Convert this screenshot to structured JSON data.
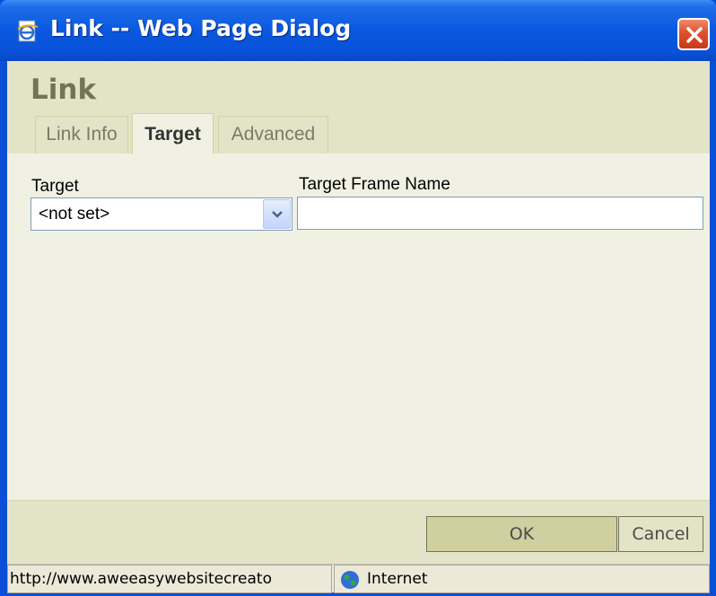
{
  "window": {
    "title": "Link -- Web Page Dialog",
    "icons": {
      "app": "ie-page-icon",
      "close": "close-icon"
    }
  },
  "dialog": {
    "title": "Link",
    "tabs": [
      {
        "label": "Link Info",
        "active": false
      },
      {
        "label": "Target",
        "active": true
      },
      {
        "label": "Advanced",
        "active": false
      }
    ]
  },
  "target_tab": {
    "target_label": "Target",
    "target_value": "<not set>",
    "frame_name_label": "Target Frame Name",
    "frame_name_value": ""
  },
  "buttons": {
    "ok": "OK",
    "cancel": "Cancel"
  },
  "statusbar": {
    "url": "http://www.aweeasywebsitecreato",
    "zone": "Internet",
    "zone_icon": "globe-icon"
  },
  "colors": {
    "titlebar": "#0a58e0",
    "dialog_bg": "#f1f1e3",
    "header_bg": "#e3e3c7",
    "ok_button": "#cfcfa0"
  }
}
